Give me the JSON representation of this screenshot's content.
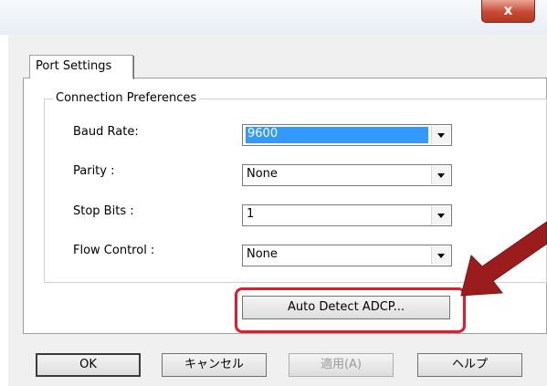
{
  "window": {
    "close_glyph": "x"
  },
  "tabs": [
    {
      "label": "Port Settings"
    }
  ],
  "group": {
    "label": "Connection Preferences"
  },
  "fields": [
    {
      "label": "Baud Rate:",
      "value": "9600",
      "selected": true
    },
    {
      "label": "Parity :",
      "value": "None"
    },
    {
      "label": "Stop Bits :",
      "value": "1"
    },
    {
      "label": "Flow Control :",
      "value": "None"
    }
  ],
  "auto_detect": {
    "label": "Auto Detect ADCP..."
  },
  "buttons": {
    "ok": "OK",
    "cancel": "キャンセル",
    "apply": "適用(A)",
    "help": "ヘルプ"
  },
  "colors": {
    "highlight": "#e8192c",
    "arrow": "#9b1c1c",
    "selection": "#3399ff"
  },
  "icons": {
    "close": "close-icon",
    "dropdown": "chevron-down-icon"
  }
}
